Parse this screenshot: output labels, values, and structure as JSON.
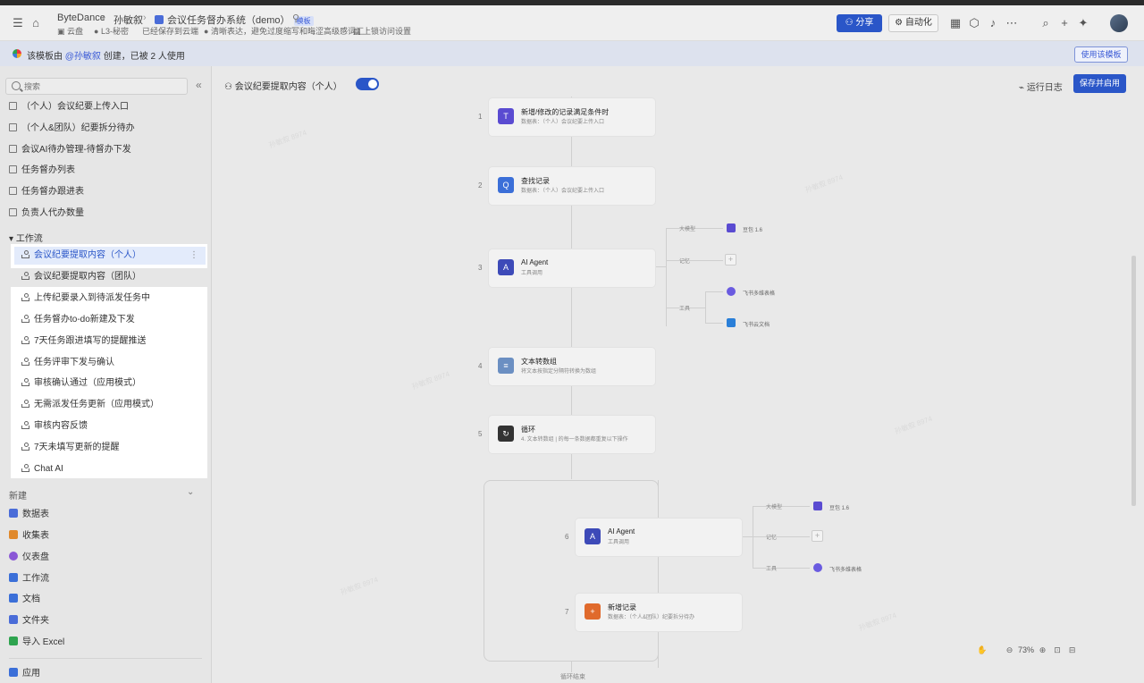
{
  "topbar": {
    "breadcrumb": [
      "ByteDance",
      "孙敏叙",
      "会议任务督办系统（demo）"
    ],
    "demo_badge": "模板",
    "pin_icon": "pin-icon",
    "subline": {
      "location": "云盘",
      "security": "L3-秘密",
      "saved": "已经保存到云端",
      "hint": "清晰表达，避免过度缩写和晦涩高级感词汇",
      "access": "上锁访问设置"
    },
    "share_label": "分享",
    "automation_label": "自动化"
  },
  "banner": {
    "prefix": "该模板由",
    "author": "@孙敏叙",
    "suffix": "创建，已被 2 人使用",
    "use_template_label": "使用该模板"
  },
  "sidebar": {
    "search_placeholder": "搜索",
    "tables": [
      "（个人）会议纪要上传入口",
      "（个人&团队）纪要拆分待办",
      "会议AI待办管理-待督办下发",
      "任务督办列表",
      "任务督办跟进表",
      "负责人代办数量"
    ],
    "workflow_section": "工作流",
    "workflows": [
      "会议纪要提取内容（个人）",
      "会议纪要提取内容（团队）",
      "上传纪要录入到待派发任务中",
      "任务督办to-do新建及下发",
      "7天任务跟进填写的提醒推送",
      "任务评审下发与确认",
      "审核确认通过（应用模式）",
      "无需派发任务更新（应用模式）",
      "审核内容反馈",
      "7天未填写更新的提醒",
      "Chat AI"
    ],
    "new_section": "新建",
    "new_items": [
      {
        "label": "数据表",
        "color": "#4a6cd8"
      },
      {
        "label": "收集表",
        "color": "#e0892c"
      },
      {
        "label": "仪表盘",
        "color": "#8a57d6"
      },
      {
        "label": "工作流",
        "color": "#3b6fd8"
      },
      {
        "label": "文档",
        "color": "#3b6fd8"
      },
      {
        "label": "文件夹",
        "color": "#4a6cd8"
      },
      {
        "label": "导入 Excel",
        "color": "#2ea44f"
      }
    ],
    "app_label": "应用"
  },
  "canvas": {
    "title": "会议纪要提取内容（个人）",
    "run_log": "运行日志",
    "save_label": "保存并启用",
    "nodes": [
      {
        "num": "1",
        "title": "新增/修改的记录满足条件时",
        "sub": "数据表：（个人）会议纪要上传入口",
        "color": "#5a4bd1",
        "icon": "T"
      },
      {
        "num": "2",
        "title": "查找记录",
        "sub": "数据表：（个人）会议纪要上传入口",
        "color": "#3b6fd8",
        "icon": "Q"
      },
      {
        "num": "3",
        "title": "AI Agent",
        "sub": "工具调用",
        "color": "#3d4ab8",
        "icon": "A"
      },
      {
        "num": "4",
        "title": "文本转数组",
        "sub": "将文本按指定分隔符转换为数组",
        "color": "#6b8fc2",
        "icon": "≡"
      },
      {
        "num": "5",
        "title": "循环",
        "sub": "4. 文本转数组 | 的每一条数据都重复以下操作",
        "color": "#333333",
        "icon": "↻"
      },
      {
        "num": "6",
        "title": "AI Agent",
        "sub": "工具调用",
        "color": "#3d4ab8",
        "icon": "A"
      },
      {
        "num": "7",
        "title": "新增记录",
        "sub": "数据表：（个人&团队）纪要拆分待办",
        "color": "#e06a2c",
        "icon": "+"
      }
    ],
    "agent_branches_top": {
      "model": "大模型",
      "memory": "记忆",
      "tools": "工具",
      "model_name": "豆包 1.6",
      "tool1": "飞书多维表格",
      "tool2": "飞书云文档"
    },
    "agent_branches_loop": {
      "model": "大模型",
      "memory": "记忆",
      "tools": "工具",
      "model_name": "豆包 1.6",
      "tool1": "飞书多维表格"
    },
    "loop_end": "循环结束",
    "zoom": "73%",
    "watermark": "孙敏叙 8974"
  }
}
